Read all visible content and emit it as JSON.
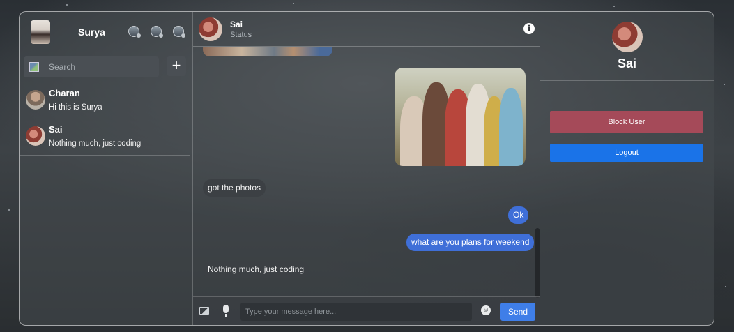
{
  "sidebar": {
    "user_name": "Surya",
    "search_placeholder": "Search",
    "add_label": "+",
    "chats": [
      {
        "name": "Charan",
        "last_message": "Hi this is Surya"
      },
      {
        "name": "Sai",
        "last_message": "Nothing much, just coding"
      }
    ]
  },
  "conversation": {
    "contact_name": "Sai",
    "contact_status": "Status",
    "info_label": "i",
    "messages": [
      {
        "direction": "incoming",
        "type": "text",
        "text": "got the photos"
      },
      {
        "direction": "outgoing",
        "type": "text",
        "text": "Ok"
      },
      {
        "direction": "outgoing",
        "type": "text",
        "text": "what are you plans for weekend"
      },
      {
        "direction": "incoming",
        "type": "text",
        "text": "Nothing much, just coding"
      }
    ],
    "composer": {
      "placeholder": "Type your message here...",
      "send_label": "Send",
      "emoji_glyph": "☺"
    }
  },
  "profile": {
    "name": "Sai",
    "block_label": "Block User",
    "logout_label": "Logout"
  },
  "colors": {
    "outgoing_bubble": "#3f6fd8",
    "incoming_bubble": "#3c4044",
    "block_button": "#a54a59",
    "logout_button": "#1a73e8",
    "send_button": "#3f7ee8"
  }
}
